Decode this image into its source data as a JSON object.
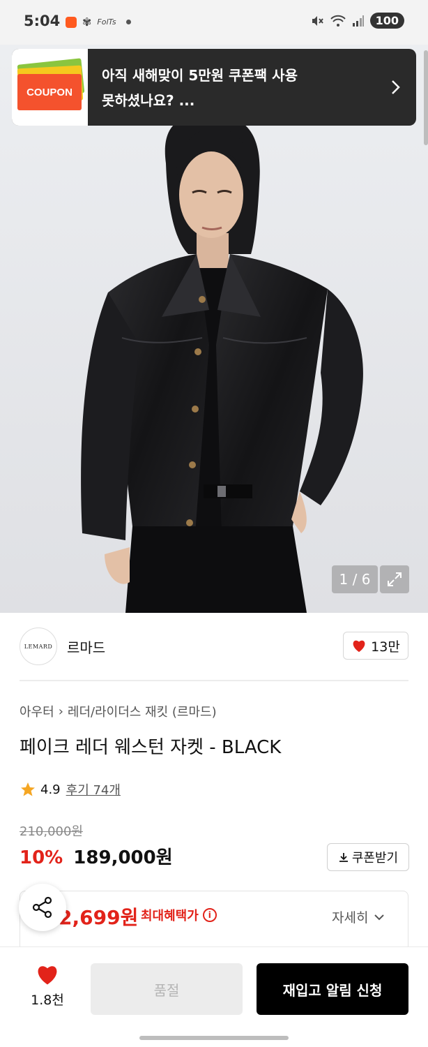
{
  "status_bar": {
    "time": "5:04",
    "battery": "100",
    "notification_text": "FolTs"
  },
  "coupon_banner": {
    "thumb_label": "COUPON",
    "text_line1": "아직 새해맞이 5만원 쿠폰팩 사용",
    "text_line2": "못하셨나요? ..."
  },
  "gallery": {
    "counter": "1 / 6"
  },
  "brand": {
    "logo_text": "LEMARD",
    "name": "르마드",
    "likes": "13만"
  },
  "breadcrumb": {
    "category": "아우터",
    "subcategory": "레더/라이더스 재킷 (르마드)"
  },
  "product": {
    "title": "페이크 레더 웨스턴 자켓 - BLACK",
    "rating": "4.9",
    "reviews": "후기 74개",
    "original_price": "210,000원",
    "discount": "10%",
    "price": "189,000원",
    "coupon_button": "쿠폰받기",
    "benefit_price": "2,699원",
    "benefit_label": "최대혜택가",
    "detail_link": "자세히"
  },
  "bottom_bar": {
    "wish_count": "1.8천",
    "soldout_label": "품절",
    "restock_label": "재입고 알림 신청"
  },
  "colors": {
    "accent_red": "#e2231a",
    "star": "#f5a623",
    "banner_bg": "#2a2a2a"
  }
}
